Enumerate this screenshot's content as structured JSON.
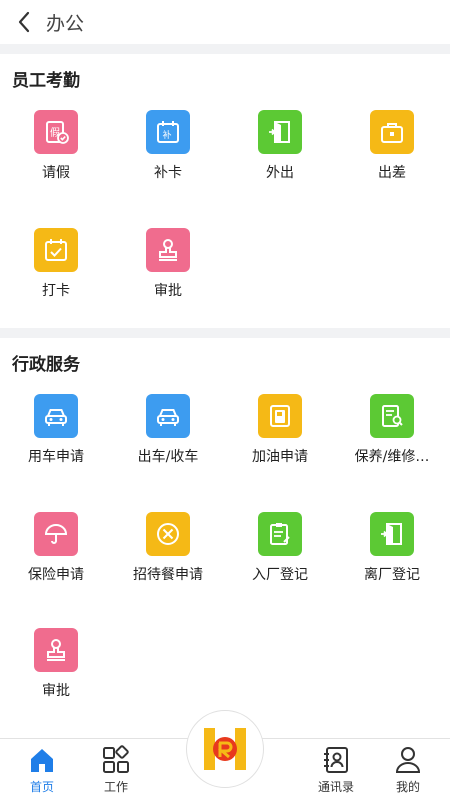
{
  "header": {
    "title": "办公"
  },
  "sections": [
    {
      "title": "员工考勤",
      "items": [
        {
          "label": "请假",
          "icon": "leave-icon",
          "color": "#f06c8e"
        },
        {
          "label": "补卡",
          "icon": "calendar-card-icon",
          "color": "#3d9cf0"
        },
        {
          "label": "外出",
          "icon": "door-exit-icon",
          "color": "#5cc934"
        },
        {
          "label": "出差",
          "icon": "briefcase-icon",
          "color": "#f5b916"
        },
        {
          "label": "打卡",
          "icon": "calendar-check-icon",
          "color": "#f5b916"
        },
        {
          "label": "审批",
          "icon": "stamp-icon",
          "color": "#f06c8e"
        }
      ]
    },
    {
      "title": "行政服务",
      "items": [
        {
          "label": "用车申请",
          "icon": "car-icon",
          "color": "#3d9cf0"
        },
        {
          "label": "出车/收车",
          "icon": "car-icon",
          "color": "#3d9cf0"
        },
        {
          "label": "加油申请",
          "icon": "fuel-icon",
          "color": "#f5b916"
        },
        {
          "label": "保养/维修…",
          "icon": "maintenance-doc-icon",
          "color": "#5cc934"
        },
        {
          "label": "保险申请",
          "icon": "umbrella-icon",
          "color": "#f06c8e"
        },
        {
          "label": "招待餐申请",
          "icon": "cutlery-icon",
          "color": "#f5b916"
        },
        {
          "label": "入厂登记",
          "icon": "register-doc-icon",
          "color": "#5cc934"
        },
        {
          "label": "离厂登记",
          "icon": "door-exit-icon",
          "color": "#5cc934"
        },
        {
          "label": "审批",
          "icon": "stamp-icon",
          "color": "#f06c8e"
        }
      ]
    }
  ],
  "tabbar": {
    "tabs": [
      {
        "label": "首页",
        "icon": "home-icon",
        "active": true
      },
      {
        "label": "工作",
        "icon": "apps-grid-icon",
        "active": false
      },
      {
        "label": "通讯录",
        "icon": "contacts-icon",
        "active": false
      },
      {
        "label": "我的",
        "icon": "profile-icon",
        "active": false
      }
    ],
    "center_icon": "company-logo-icon"
  },
  "colors": {
    "accent": "#1f7ee8",
    "pink": "#f06c8e",
    "blue": "#3d9cf0",
    "green": "#5cc934",
    "yellow": "#f5b916",
    "section_gap": "#f1f2f4"
  }
}
